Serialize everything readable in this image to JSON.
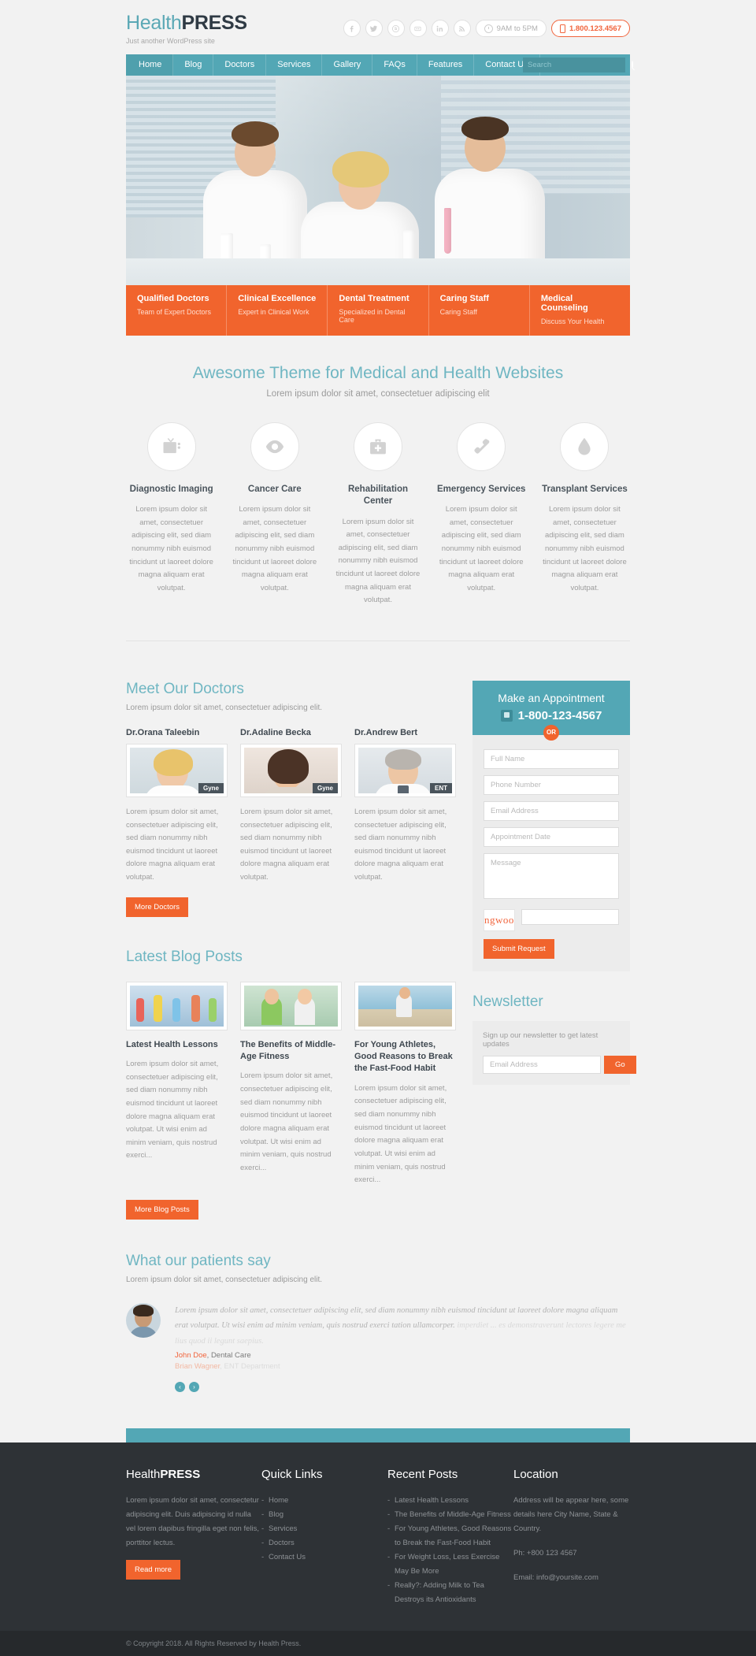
{
  "header": {
    "logo_light": "Health",
    "logo_bold": "PRESS",
    "tagline": "Just another WordPress site",
    "social": [
      {
        "name": "facebook-icon",
        "glyph": "f"
      },
      {
        "name": "twitter-icon",
        "glyph": "t"
      },
      {
        "name": "skype-icon",
        "glyph": "s"
      },
      {
        "name": "flickr-icon",
        "glyph": "fl"
      },
      {
        "name": "linkedin-icon",
        "glyph": "in"
      },
      {
        "name": "rss-icon",
        "glyph": "rss"
      }
    ],
    "hours": "9AM to 5PM",
    "phone": "1.800.123.4567"
  },
  "nav": {
    "items": [
      {
        "label": "Home",
        "active": true
      },
      {
        "label": "Blog",
        "active": false
      },
      {
        "label": "Doctors",
        "active": false
      },
      {
        "label": "Services",
        "active": false
      },
      {
        "label": "Gallery",
        "active": false
      },
      {
        "label": "FAQs",
        "active": false
      },
      {
        "label": "Features",
        "active": false
      },
      {
        "label": "Contact Us",
        "active": false
      }
    ],
    "search_placeholder": "Search"
  },
  "features": [
    {
      "title": "Qualified Doctors",
      "sub": "Team of Expert Doctors"
    },
    {
      "title": "Clinical Excellence",
      "sub": "Expert in Clinical Work"
    },
    {
      "title": "Dental Treatment",
      "sub": "Specialized in Dental Care"
    },
    {
      "title": "Caring Staff",
      "sub": "Caring Staff"
    },
    {
      "title": "Medical Counseling",
      "sub": "Discuss Your Health"
    }
  ],
  "services": {
    "title": "Awesome Theme for Medical and Health Websites",
    "subtitle": "Lorem ipsum dolor sit amet, consectetuer adipiscing elit",
    "body": "Lorem ipsum dolor sit amet, consectetuer adipiscing elit, sed diam nonummy nibh euismod tincidunt ut laoreet dolore magna aliquam erat volutpat.",
    "items": [
      {
        "title": "Diagnostic Imaging",
        "icon": "monitor-icon"
      },
      {
        "title": "Cancer Care",
        "icon": "eye-icon"
      },
      {
        "title": "Rehabilitation Center",
        "icon": "medical-bag-icon"
      },
      {
        "title": "Emergency Services",
        "icon": "phone-receiver-icon"
      },
      {
        "title": "Transplant Services",
        "icon": "blood-drop-icon"
      }
    ]
  },
  "doctors": {
    "title": "Meet Our Doctors",
    "subtitle": "Lorem ipsum dolor sit amet, consectetuer adipiscing elit.",
    "body": "Lorem ipsum dolor sit amet, consectetuer adipiscing elit, sed diam nonummy nibh euismod tincidunt ut laoreet dolore magna aliquam erat volutpat.",
    "more_label": "More Doctors",
    "items": [
      {
        "name": "Dr.Orana Taleebin",
        "badge": "Gyne"
      },
      {
        "name": "Dr.Adaline Becka",
        "badge": "Gyne"
      },
      {
        "name": "Dr.Andrew Bert",
        "badge": "ENT"
      }
    ]
  },
  "appointment": {
    "title": "Make an Appointment",
    "phone": "1-800-123-4567",
    "or_label": "OR",
    "fields": {
      "name": "Full Name",
      "phone": "Phone Number",
      "email": "Email Address",
      "date": "Appointment Date",
      "message": "Message"
    },
    "captcha_text": "ngwoo",
    "submit_label": "Submit Request"
  },
  "newsletter": {
    "title": "Newsletter",
    "text": "Sign up our newsletter to get latest updates",
    "placeholder": "Email Address",
    "button": "Go"
  },
  "blog": {
    "title": "Latest Blog Posts",
    "more_label": "More Blog Posts",
    "posts": [
      {
        "title": "Latest Health Lessons",
        "excerpt": "Lorem ipsum dolor sit amet, consectetuer adipiscing elit, sed diam nonummy nibh euismod tincidunt ut laoreet dolore magna aliquam erat volutpat. Ut wisi enim ad minim veniam, quis nostrud exerci..."
      },
      {
        "title": "The Benefits of Middle-Age Fitness",
        "excerpt": "Lorem ipsum dolor sit amet, consectetuer adipiscing elit, sed diam nonummy nibh euismod tincidunt ut laoreet dolore magna aliquam erat volutpat. Ut wisi enim ad minim veniam, quis nostrud exerci..."
      },
      {
        "title": "For Young Athletes, Good Reasons to Break the Fast-Food Habit",
        "excerpt": "Lorem ipsum dolor sit amet, consectetuer adipiscing elit, sed diam nonummy nibh euismod tincidunt ut laoreet dolore magna aliquam erat volutpat. Ut wisi enim ad minim veniam, quis nostrud exerci..."
      }
    ]
  },
  "testimonials": {
    "title": "What our patients say",
    "subtitle": "Lorem ipsum dolor sit amet, consectetuer adipiscing elit.",
    "quote_front": "Lorem ipsum dolor sit amet, consectetuer adipiscing elit, sed diam nonummy nibh euismod tincidunt ut laoreet dolore magna aliquam erat volutpat. Ut wisi enim ad minim veniam, quis nostrud exerci tation ullamcorper.",
    "quote_ghost": "imperdiet ... es demonstraverunt lectores legere me lius quod ii legunt saepius.",
    "cite_name": "John Doe",
    "cite_role": ", Dental Care",
    "cite_name_fade": "Brian Wagner",
    "cite_role_fade": ", ENT Department",
    "prev_label": "‹",
    "next_label": "›"
  },
  "footer": {
    "about": {
      "logo_light": "Health",
      "logo_bold": "PRESS",
      "text": "Lorem ipsum dolor sit amet, consectetur adipiscing elit. Duis adipiscing id nulla vel lorem dapibus fringilla eget non felis, porttitor lectus.",
      "button": "Read more"
    },
    "quick_links": {
      "title": "Quick Links",
      "items": [
        "Home",
        "Blog",
        "Services",
        "Doctors",
        "Contact Us"
      ]
    },
    "recent_posts": {
      "title": "Recent Posts",
      "items": [
        "Latest Health Lessons",
        "The Benefits of Middle-Age Fitness",
        "For Young Athletes, Good Reasons to Break the Fast-Food Habit",
        "For Weight Loss, Less Exercise May Be More",
        "Really?: Adding Milk to Tea Destroys its Antioxidants"
      ]
    },
    "location": {
      "title": "Location",
      "address": "Address will be appear here, some details here City Name, State & Country.",
      "phone_label": "Ph:",
      "phone": "+800 123 4567",
      "email_label": "Email:",
      "email": "info@yoursite.com"
    },
    "copyright": "© Copyright 2018. All Rights Reserved by Health Press."
  },
  "colors": {
    "teal": "#53a7b5",
    "orange": "#f1642d",
    "dark": "#2e3236"
  }
}
